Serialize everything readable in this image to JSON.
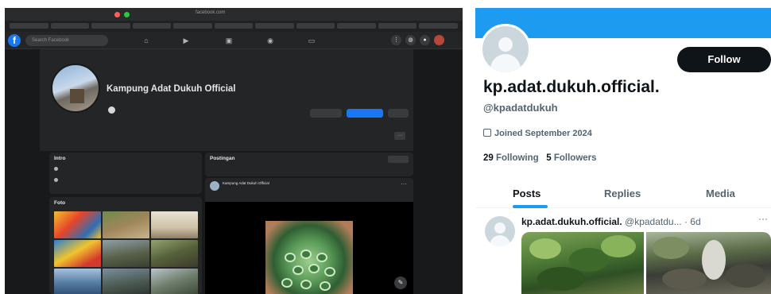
{
  "facebook": {
    "browser": {
      "url": "facebook.com",
      "tab_count": "",
      "bookmarks": [
        "",
        "",
        "",
        "",
        "",
        "",
        "",
        "",
        "",
        "",
        ""
      ]
    },
    "nav": {
      "logo": "f",
      "search_placeholder": "Search Facebook"
    },
    "profile": {
      "name": "Kampung Adat Dukuh Official",
      "subtitle": "",
      "buttons": {
        "message": "",
        "follow": "",
        "more": ""
      },
      "tabs": [
        "",
        "",
        "",
        "",
        "",
        "",
        ""
      ]
    },
    "intro": {
      "title": "Intro",
      "lines": [
        "",
        ""
      ]
    },
    "photos": {
      "title": "Foto",
      "see_all": ""
    },
    "posts": {
      "title": "Postingan",
      "filter_label": "",
      "post": {
        "author": "Kampung Adat Dukuh Official",
        "time": "",
        "text": ""
      }
    }
  },
  "twitter": {
    "follow_label": "Follow",
    "name": "kp.adat.dukuh.official.",
    "handle": "@kpadatdukuh",
    "joined": "Joined September 2024",
    "following_count": "29",
    "following_label": "Following",
    "followers_count": "5",
    "followers_label": "Followers",
    "tabs": [
      "Posts",
      "Replies",
      "Media"
    ],
    "post": {
      "name": "kp.adat.dukuh.official.",
      "handle": "@kpadatdu...",
      "time": "· 6d",
      "more": "···"
    }
  },
  "colors": {
    "fb_bg": "#18191a",
    "fb_card": "#242526",
    "fb_blue": "#1877f2",
    "x_blue": "#1d9bf0",
    "x_text": "#0f1419"
  },
  "icons": [
    "facebook-logo-icon",
    "home-icon",
    "video-icon",
    "marketplace-icon",
    "groups-icon",
    "gaming-icon",
    "menu-icon",
    "messenger-icon",
    "bell-icon",
    "calendar-icon",
    "default-avatar-icon"
  ]
}
